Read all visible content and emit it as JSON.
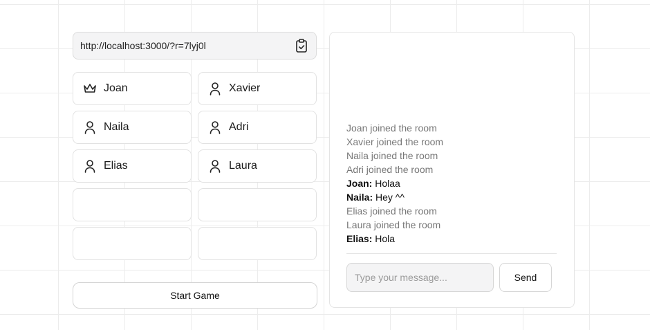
{
  "room": {
    "invite_url": "http://localhost:3000/?r=7lyj0l",
    "copy_icon": "clipboard-check-icon"
  },
  "players": [
    {
      "name": "Joan",
      "icon": "crown-icon",
      "role": "host"
    },
    {
      "name": "Xavier",
      "icon": "user-icon",
      "role": "player"
    },
    {
      "name": "Naila",
      "icon": "user-icon",
      "role": "player"
    },
    {
      "name": "Adri",
      "icon": "user-icon",
      "role": "player"
    },
    {
      "name": "Elias",
      "icon": "user-icon",
      "role": "player"
    },
    {
      "name": "Laura",
      "icon": "user-icon",
      "role": "player"
    }
  ],
  "empty_slots": 4,
  "actions": {
    "start_label": "Start Game"
  },
  "chat": {
    "messages": [
      {
        "type": "system",
        "text": "Joan joined the room"
      },
      {
        "type": "system",
        "text": "Xavier joined the room"
      },
      {
        "type": "system",
        "text": "Naila joined the room"
      },
      {
        "type": "system",
        "text": "Adri joined the room"
      },
      {
        "type": "user",
        "author": "Joan:",
        "text": "Holaa"
      },
      {
        "type": "user",
        "author": "Naila:",
        "text": "Hey ^^"
      },
      {
        "type": "system",
        "text": "Elias joined the room"
      },
      {
        "type": "system",
        "text": "Laura joined the room"
      },
      {
        "type": "user",
        "author": "Elias:",
        "text": "Hola"
      }
    ],
    "input_placeholder": "Type your message...",
    "input_value": "",
    "send_label": "Send"
  },
  "colors": {
    "system_text": "#777777",
    "input_background": "#f4f4f5",
    "border": "#e2e2e2"
  }
}
